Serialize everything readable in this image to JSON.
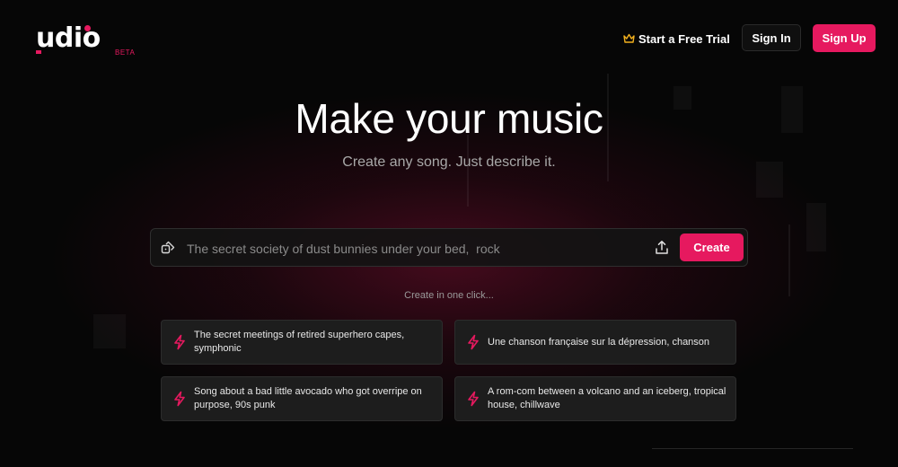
{
  "app": {
    "logo_text": "udio",
    "beta_label": "BETA",
    "brand_color": "#e6195f"
  },
  "header": {
    "trial": {
      "label": "Start a Free Trial",
      "icon": "crown-icon",
      "icon_color": "#f2b01e"
    },
    "sign_in_label": "Sign In",
    "sign_up_label": "Sign Up"
  },
  "hero": {
    "title": "Make your music",
    "subtitle": "Create any song. Just describe it."
  },
  "prompt": {
    "placeholder": "The secret society of dust bunnies under your bed,  rock",
    "value": "",
    "random_icon": "dice-icon",
    "upload_icon": "upload-icon",
    "create_label": "Create"
  },
  "suggestions": {
    "heading": "Create in one click...",
    "icon": "bolt-icon",
    "items": [
      {
        "text": "The secret meetings of retired superhero capes, symphonic"
      },
      {
        "text": "Une chanson française sur la dépression, chanson"
      },
      {
        "text": "Song about a bad little avocado who got overripe on purpose, 90s punk"
      },
      {
        "text": "A rom-com between a volcano and an iceberg, tropical house, chillwave"
      }
    ]
  }
}
